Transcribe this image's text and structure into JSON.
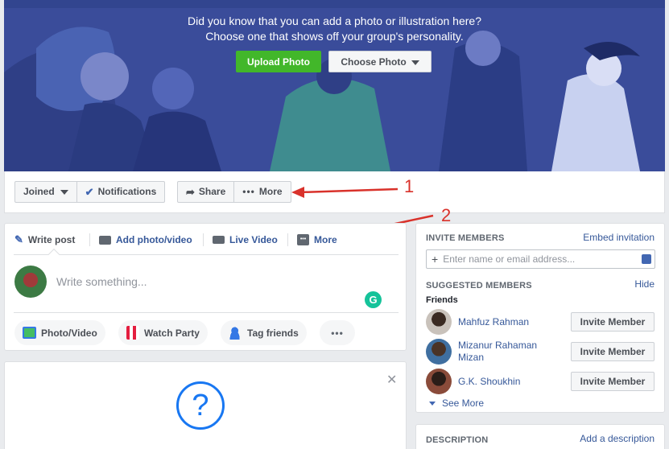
{
  "cover": {
    "prompt_line1": "Did you know that you can add a photo or illustration here?",
    "prompt_line2": "Choose one that shows off your group's personality.",
    "upload_label": "Upload Photo",
    "choose_label": "Choose Photo"
  },
  "action_bar": {
    "joined_label": "Joined",
    "notifications_label": "Notifications",
    "share_label": "Share",
    "more_label": "More"
  },
  "annotations": {
    "one": "1",
    "two": "2"
  },
  "composer": {
    "tabs": [
      {
        "label": "Write post",
        "icon": "pencil-icon"
      },
      {
        "label": "Add photo/video",
        "icon": "camera-icon"
      },
      {
        "label": "Live Video",
        "icon": "video-camera-icon"
      },
      {
        "label": "More",
        "icon": "more-dots-icon"
      }
    ],
    "placeholder": "Write something...",
    "actions": [
      {
        "label": "Photo/Video",
        "icon": "photo-icon"
      },
      {
        "label": "Watch Party",
        "icon": "popcorn-icon"
      },
      {
        "label": "Tag friends",
        "icon": "tag-person-icon"
      },
      {
        "label": "",
        "icon": "more-dots-icon"
      }
    ]
  },
  "sidebar": {
    "invite_title": "INVITE MEMBERS",
    "embed_link": "Embed invitation",
    "invite_placeholder": "Enter name or email address...",
    "suggested_title": "SUGGESTED MEMBERS",
    "hide_link": "Hide",
    "friends_label": "Friends",
    "members": [
      {
        "name": "Mahfuz Rahman",
        "button": "Invite Member"
      },
      {
        "name": "Mizanur Rahaman Mizan",
        "button": "Invite Member"
      },
      {
        "name": "G.K. Shoukhin",
        "button": "Invite Member"
      }
    ],
    "see_more": "See More",
    "description_title": "DESCRIPTION",
    "add_description": "Add a description"
  },
  "colors": {
    "brand_blue": "#365899",
    "upload_green": "#42b72a",
    "annotation_red": "#d9322b",
    "cover_bg": "#3b4f9e"
  }
}
